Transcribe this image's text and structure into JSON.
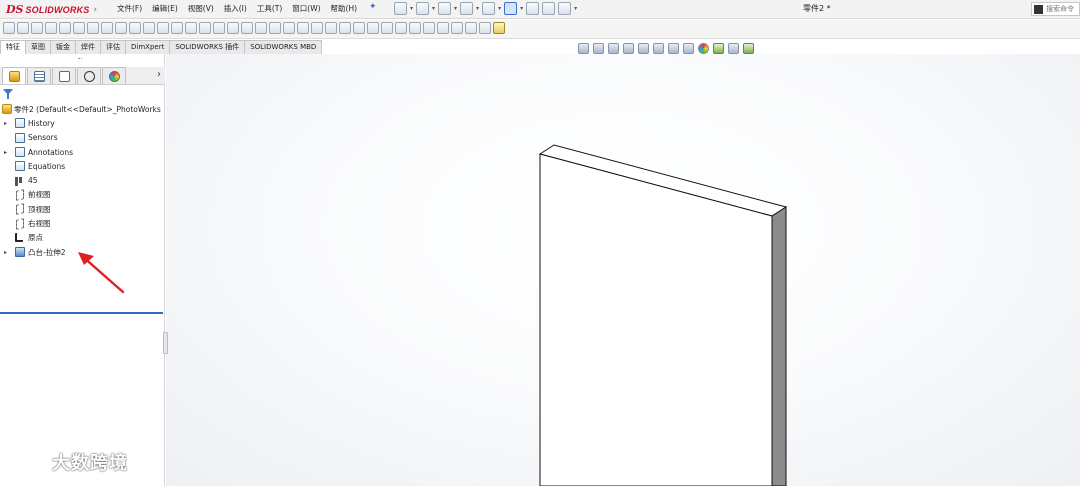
{
  "app": {
    "logo_ds": "DS",
    "logo_text": "SOLIDWORKS",
    "document_title": "零件2 *",
    "search_placeholder": "搜索命令"
  },
  "menu": [
    {
      "label": "文件(F)"
    },
    {
      "label": "编辑(E)"
    },
    {
      "label": "视图(V)"
    },
    {
      "label": "插入(I)"
    },
    {
      "label": "工具(T)"
    },
    {
      "label": "窗口(W)"
    },
    {
      "label": "帮助(H)"
    }
  ],
  "tabs": [
    {
      "label": "特征"
    },
    {
      "label": "草图"
    },
    {
      "label": "钣金"
    },
    {
      "label": "焊件"
    },
    {
      "label": "评估"
    },
    {
      "label": "DimXpert"
    },
    {
      "label": "SOLIDWORKS 插件"
    },
    {
      "label": "SOLIDWORKS MBD"
    }
  ],
  "feature_tree": {
    "root": "零件2 (Default<<Default>_PhotoWorks",
    "items": [
      {
        "label": "History",
        "icon": "history-icon",
        "expandable": true
      },
      {
        "label": "Sensors",
        "icon": "sensors-icon",
        "expandable": false
      },
      {
        "label": "Annotations",
        "icon": "annotations-icon",
        "expandable": true
      },
      {
        "label": "Equations",
        "icon": "equations-icon",
        "expandable": false
      },
      {
        "label": "45",
        "icon": "material-icon",
        "expandable": false
      },
      {
        "label": "前视图",
        "icon": "plane-icon",
        "expandable": false
      },
      {
        "label": "顶视图",
        "icon": "plane-icon",
        "expandable": false
      },
      {
        "label": "右视图",
        "icon": "plane-icon",
        "expandable": false
      },
      {
        "label": "原点",
        "icon": "origin-icon",
        "expandable": false
      },
      {
        "label": "凸台-拉伸2",
        "icon": "extrude-feature-icon",
        "expandable": true
      }
    ]
  },
  "watermark": {
    "text": "大数跨境"
  },
  "colors": {
    "brand_red": "#c8102e",
    "rollback_bar": "#2f67c6",
    "annotation_arrow": "#e02020"
  }
}
